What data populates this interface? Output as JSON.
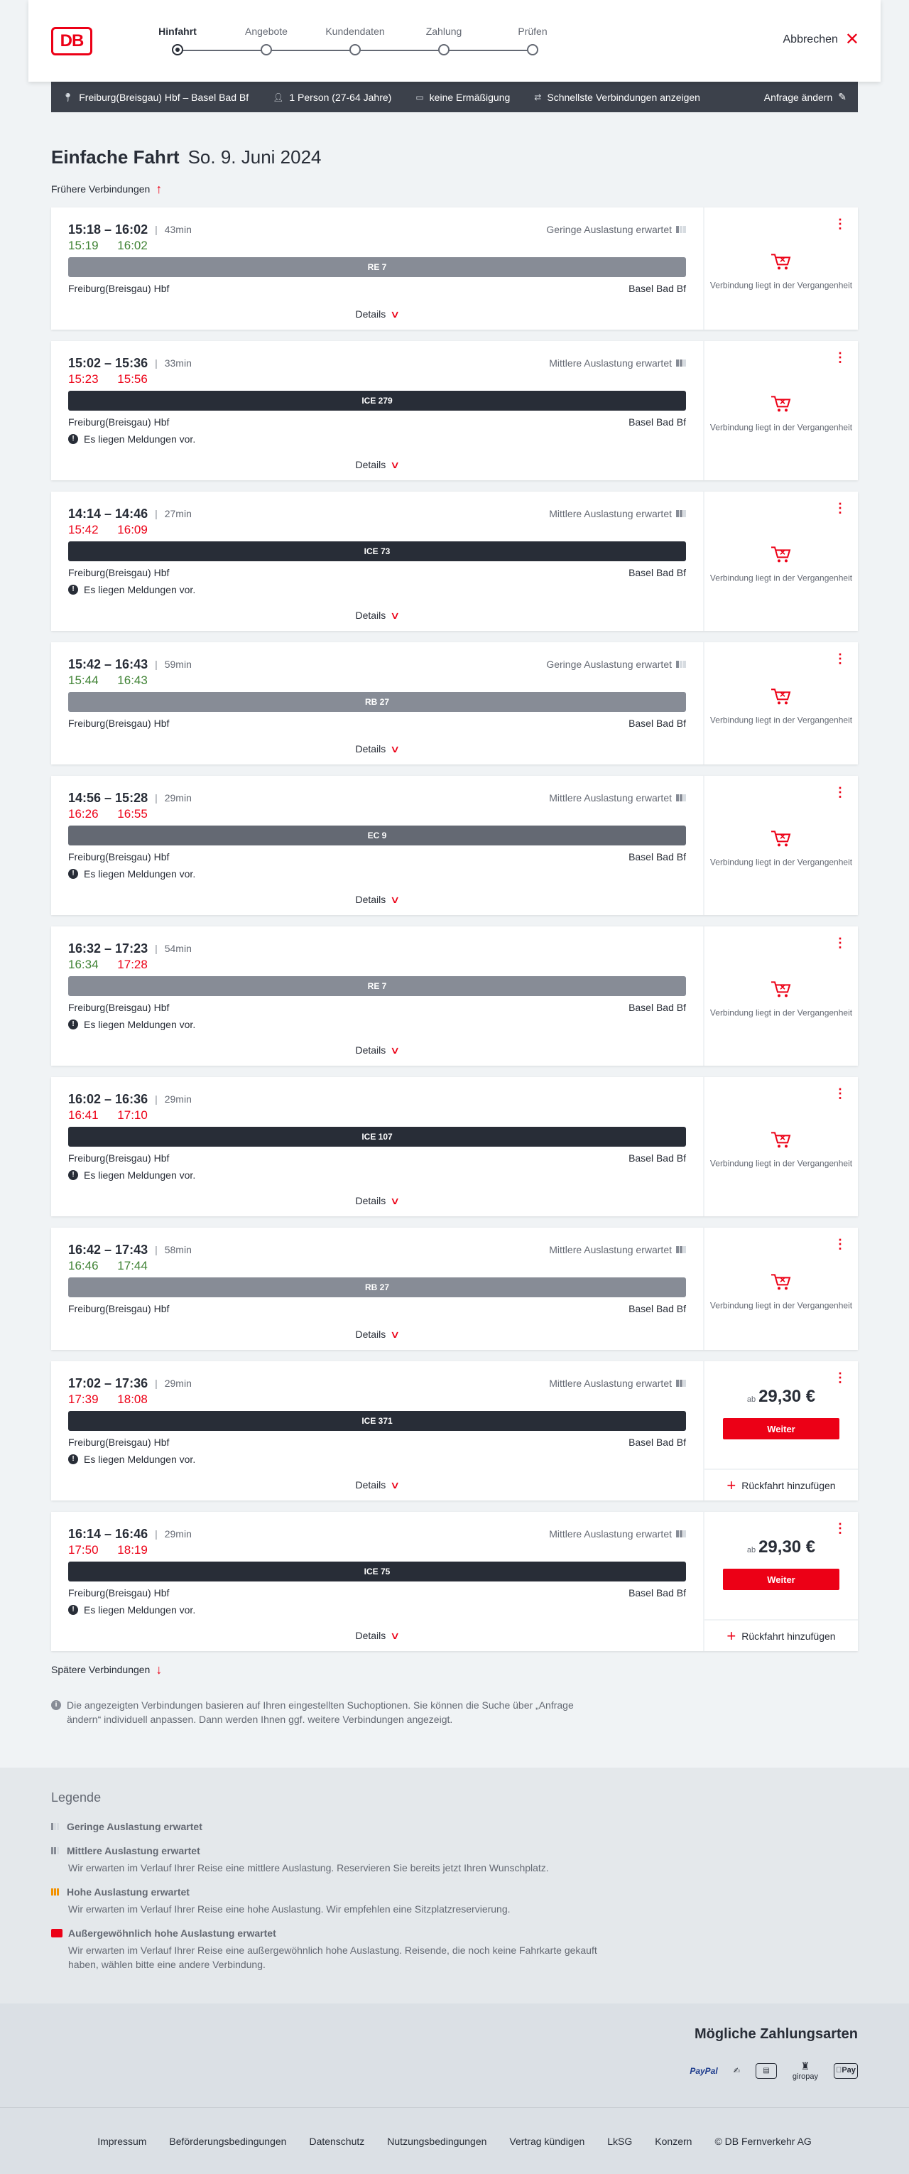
{
  "header": {
    "logo": "DB",
    "steps": [
      {
        "label": "Hinfahrt",
        "active": true
      },
      {
        "label": "Angebote",
        "active": false
      },
      {
        "label": "Kundendaten",
        "active": false
      },
      {
        "label": "Zahlung",
        "active": false
      },
      {
        "label": "Prüfen",
        "active": false
      }
    ],
    "cancel_label": "Abbrechen"
  },
  "search": {
    "route": "Freiburg(Breisgau) Hbf – Basel Bad Bf",
    "travellers": "1 Person (27-64 Jahre)",
    "discount": "keine Ermäßigung",
    "option": "Schnellste Verbindungen anzeigen",
    "change_label": "Anfrage ändern"
  },
  "title": {
    "heading": "Einfache Fahrt",
    "date": "So. 9. Juni 2024"
  },
  "earlier_label": "Frühere Verbindungen",
  "later_label": "Spätere Verbindungen",
  "details_label": "Details",
  "notice_text": "Es liegen Meldungen vor.",
  "past_text": "Verbindung liegt in der Vergangenheit",
  "price_prefix": "ab",
  "continue_label": "Weiter",
  "return_label": "Rückfahrt hinzufügen",
  "connections": [
    {
      "times": "15:18 – 16:02",
      "duration": "43min",
      "load": "Geringe Auslastung erwartet",
      "load_level": 1,
      "rt_dep": "15:19",
      "rt_arr": "16:02",
      "rt_status": "ok",
      "train": "RE 7",
      "train_type": "regio",
      "from": "Freiburg(Breisgau) Hbf",
      "to": "Basel Bad Bf",
      "notice": false,
      "bookable": false
    },
    {
      "times": "15:02 – 15:36",
      "duration": "33min",
      "load": "Mittlere Auslastung erwartet",
      "load_level": 2,
      "rt_dep": "15:23",
      "rt_arr": "15:56",
      "rt_status": "late",
      "train": "ICE 279",
      "train_type": "fern",
      "from": "Freiburg(Breisgau) Hbf",
      "to": "Basel Bad Bf",
      "notice": true,
      "bookable": false
    },
    {
      "times": "14:14 – 14:46",
      "duration": "27min",
      "load": "Mittlere Auslastung erwartet",
      "load_level": 2,
      "rt_dep": "15:42",
      "rt_arr": "16:09",
      "rt_status": "late",
      "train": "ICE 73",
      "train_type": "fern",
      "from": "Freiburg(Breisgau) Hbf",
      "to": "Basel Bad Bf",
      "notice": true,
      "bookable": false
    },
    {
      "times": "15:42 – 16:43",
      "duration": "59min",
      "load": "Geringe Auslastung erwartet",
      "load_level": 1,
      "rt_dep": "15:44",
      "rt_arr": "16:43",
      "rt_status": "ok",
      "train": "RB 27",
      "train_type": "regio",
      "from": "Freiburg(Breisgau) Hbf",
      "to": "Basel Bad Bf",
      "notice": false,
      "bookable": false
    },
    {
      "times": "14:56 – 15:28",
      "duration": "29min",
      "load": "Mittlere Auslastung erwartet",
      "load_level": 2,
      "rt_dep": "16:26",
      "rt_arr": "16:55",
      "rt_status": "late",
      "train": "EC 9",
      "train_type": "ec",
      "from": "Freiburg(Breisgau) Hbf",
      "to": "Basel Bad Bf",
      "notice": true,
      "bookable": false
    },
    {
      "times": "16:32 – 17:23",
      "duration": "54min",
      "load": "",
      "load_level": 0,
      "rt_dep": "16:34",
      "rt_arr": "17:28",
      "rt_status": "mixed",
      "train": "RE 7",
      "train_type": "regio",
      "from": "Freiburg(Breisgau) Hbf",
      "to": "Basel Bad Bf",
      "notice": true,
      "bookable": false
    },
    {
      "times": "16:02 – 16:36",
      "duration": "29min",
      "load": "",
      "load_level": 0,
      "rt_dep": "16:41",
      "rt_arr": "17:10",
      "rt_status": "late",
      "train": "ICE 107",
      "train_type": "fern",
      "from": "Freiburg(Breisgau) Hbf",
      "to": "Basel Bad Bf",
      "notice": true,
      "bookable": false
    },
    {
      "times": "16:42 – 17:43",
      "duration": "58min",
      "load": "Mittlere Auslastung erwartet",
      "load_level": 2,
      "rt_dep": "16:46",
      "rt_arr": "17:44",
      "rt_status": "ok",
      "train": "RB 27",
      "train_type": "regio",
      "from": "Freiburg(Breisgau) Hbf",
      "to": "Basel Bad Bf",
      "notice": false,
      "bookable": false
    },
    {
      "times": "17:02 – 17:36",
      "duration": "29min",
      "load": "Mittlere Auslastung erwartet",
      "load_level": 2,
      "rt_dep": "17:39",
      "rt_arr": "18:08",
      "rt_status": "late",
      "train": "ICE 371",
      "train_type": "fern",
      "from": "Freiburg(Breisgau) Hbf",
      "to": "Basel Bad Bf",
      "notice": true,
      "bookable": true,
      "price": "29,30 €"
    },
    {
      "times": "16:14 – 16:46",
      "duration": "29min",
      "load": "Mittlere Auslastung erwartet",
      "load_level": 2,
      "rt_dep": "17:50",
      "rt_arr": "18:19",
      "rt_status": "late",
      "train": "ICE 75",
      "train_type": "fern",
      "from": "Freiburg(Breisgau) Hbf",
      "to": "Basel Bad Bf",
      "notice": true,
      "bookable": true,
      "price": "29,30 €"
    }
  ],
  "info_text": "Die angezeigten Verbindungen basieren auf Ihren eingestellten Suchoptionen. Sie können die Suche über „Anfrage ändern“ individuell anpassen. Dann werden Ihnen ggf. weitere Verbindungen angezeigt.",
  "legend": {
    "title": "Legende",
    "items": [
      {
        "title": "Geringe Auslastung erwartet",
        "desc": "",
        "level": "low"
      },
      {
        "title": "Mittlere Auslastung erwartet",
        "desc": "Wir erwarten im Verlauf Ihrer Reise eine mittlere Auslastung. Reservieren Sie bereits jetzt Ihren Wunschplatz.",
        "level": "mid"
      },
      {
        "title": "Hohe Auslastung erwartet",
        "desc": "Wir erwarten im Verlauf Ihrer Reise eine hohe Auslastung. Wir empfehlen eine Sitzplatzreservierung.",
        "level": "high"
      },
      {
        "title": "Außergewöhnlich hohe Auslastung erwartet",
        "desc": "Wir erwarten im Verlauf Ihrer Reise eine außergewöhnlich hohe Auslastung. Reisende, die noch keine Fahrkarte gekauft haben, wählen bitte eine andere Verbindung.",
        "level": "xhigh"
      }
    ]
  },
  "payments": {
    "title": "Mögliche Zahlungsarten",
    "methods": [
      "PayPal",
      "giropay",
      "Pay"
    ]
  },
  "footer": {
    "links": [
      "Impressum",
      "Beförderungsbedingungen",
      "Datenschutz",
      "Nutzungsbedingungen",
      "Vertrag kündigen",
      "LkSG",
      "Konzern",
      "© DB Fernverkehr AG"
    ]
  }
}
